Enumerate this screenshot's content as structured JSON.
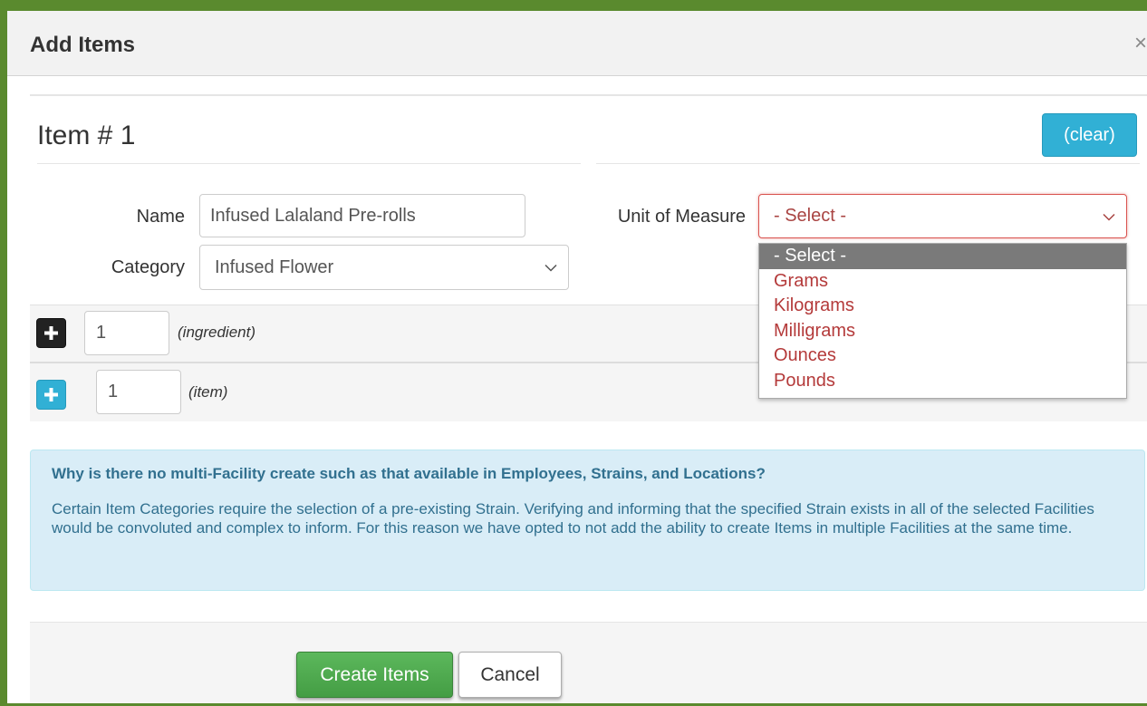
{
  "modal": {
    "title": "Add Items",
    "close_label": "×"
  },
  "item": {
    "heading": "Item # 1",
    "clear_label": "(clear)"
  },
  "form": {
    "name_label": "Name",
    "name_value": "Infused Lalaland Pre-rolls",
    "category_label": "Category",
    "category_value": "Infused Flower",
    "uom_label": "Unit of Measure",
    "uom_value": "- Select -",
    "uom_options": [
      "- Select -",
      "Grams",
      "Kilograms",
      "Milligrams",
      "Ounces",
      "Pounds"
    ],
    "uom_selected_index": 0
  },
  "ingredients": {
    "count": "1",
    "hint": "(ingredient)"
  },
  "items": {
    "count": "1",
    "hint": "(item)"
  },
  "info": {
    "title": "Why is there no multi-Facility create such as that available in Employees, Strains, and Locations?",
    "body": "Certain Item Categories require the selection of a pre-existing Strain. Verifying and informing that the specified Strain exists in all of the selected Facilities would be convoluted and complex to inform. For this reason we have opted to not add the ability to create Items in multiple Facilities at the same time."
  },
  "footer": {
    "create_label": "Create Items",
    "cancel_label": "Cancel"
  },
  "colors": {
    "page_frame": "#5a8a2e",
    "info_accent": "#31708f",
    "primary_green": "#5cb85c",
    "info_blue": "#31b0d5",
    "error_red": "#d9534f"
  },
  "icons": {
    "close": "close-icon",
    "plus": "plus-icon",
    "chevron": "chevron-down-icon"
  }
}
